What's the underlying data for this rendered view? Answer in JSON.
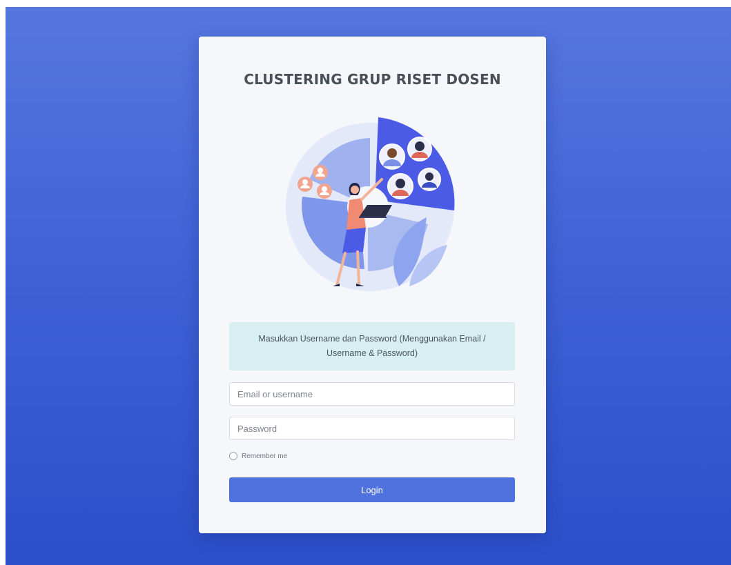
{
  "app": {
    "title": "CLUSTERING GRUP RISET DOSEN"
  },
  "illustration": {
    "icon": "team-research-cluster-illustration"
  },
  "alert": {
    "text": "Masukkan Username dan Password (Menggunakan Email / Username & Password)"
  },
  "form": {
    "email_placeholder": "Email or username",
    "email_value": "",
    "password_placeholder": "Password",
    "password_value": "",
    "remember_label": "Remember me",
    "remember_checked": false,
    "login_label": "Login"
  },
  "colors": {
    "background_top": "#5677df",
    "background_bottom": "#2b4fc9",
    "card": "#f5f7fb",
    "alert_bg": "#d7eff1",
    "primary_button": "#4f72df"
  }
}
